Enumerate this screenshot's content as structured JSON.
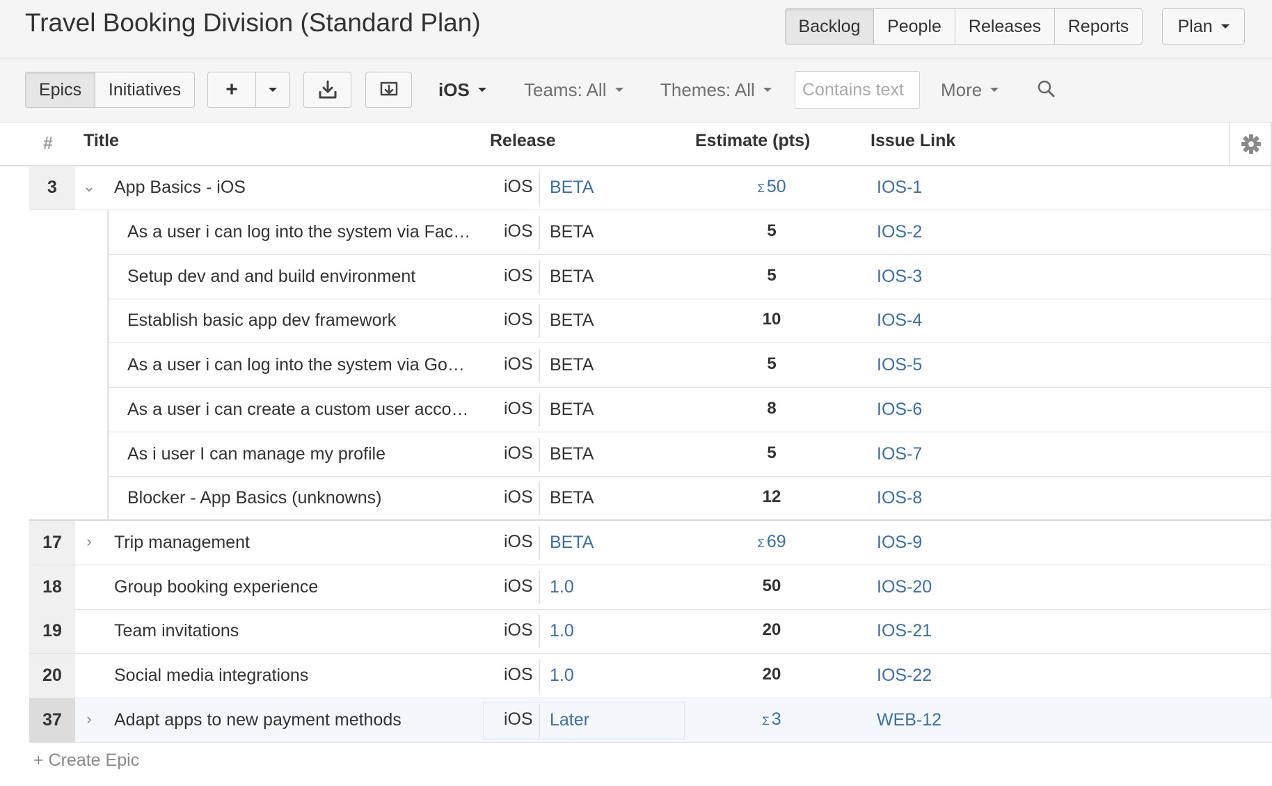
{
  "header": {
    "title": "Travel Booking Division (Standard Plan)",
    "nav": [
      "Backlog",
      "People",
      "Releases",
      "Reports"
    ],
    "active_nav": "Backlog",
    "plan_label": "Plan"
  },
  "toolbar": {
    "view_tabs": [
      "Epics",
      "Initiatives"
    ],
    "active_view": "Epics",
    "add_label": "+",
    "team_filter": "iOS",
    "teams_filter": "Teams: All",
    "themes_filter": "Themes: All",
    "search_placeholder": "Contains text",
    "more_label": "More"
  },
  "table": {
    "columns": {
      "num": "#",
      "title": "Title",
      "release": "Release",
      "estimate": "Estimate (pts)",
      "issue": "Issue Link"
    },
    "rows": [
      {
        "num": "3",
        "title": "App Basics - iOS",
        "team": "iOS",
        "release": "BETA",
        "estimate": "50",
        "issue": "IOS-1"
      },
      {
        "num": "",
        "title": "As a user i can log into the system via Fac…",
        "team": "iOS",
        "release": "BETA",
        "estimate": "5",
        "issue": "IOS-2"
      },
      {
        "num": "",
        "title": "Setup dev and and build environment",
        "team": "iOS",
        "release": "BETA",
        "estimate": "5",
        "issue": "IOS-3"
      },
      {
        "num": "",
        "title": "Establish basic app dev framework",
        "team": "iOS",
        "release": "BETA",
        "estimate": "10",
        "issue": "IOS-4"
      },
      {
        "num": "",
        "title": "As a user i can log into the system via Go…",
        "team": "iOS",
        "release": "BETA",
        "estimate": "5",
        "issue": "IOS-5"
      },
      {
        "num": "",
        "title": "As a user i can create a custom user acco…",
        "team": "iOS",
        "release": "BETA",
        "estimate": "8",
        "issue": "IOS-6"
      },
      {
        "num": "",
        "title": "As i user I can manage my profile",
        "team": "iOS",
        "release": "BETA",
        "estimate": "5",
        "issue": "IOS-7"
      },
      {
        "num": "",
        "title": "Blocker - App Basics (unknowns)",
        "team": "iOS",
        "release": "BETA",
        "estimate": "12",
        "issue": "IOS-8"
      },
      {
        "num": "17",
        "title": "Trip management",
        "team": "iOS",
        "release": "BETA",
        "estimate": "69",
        "issue": "IOS-9"
      },
      {
        "num": "18",
        "title": "Group booking experience",
        "team": "iOS",
        "release": "1.0",
        "estimate": "50",
        "issue": "IOS-20"
      },
      {
        "num": "19",
        "title": "Team invitations",
        "team": "iOS",
        "release": "1.0",
        "estimate": "20",
        "issue": "IOS-21"
      },
      {
        "num": "20",
        "title": "Social media integrations",
        "team": "iOS",
        "release": "1.0",
        "estimate": "20",
        "issue": "IOS-22"
      },
      {
        "num": "37",
        "title": "Adapt apps to new payment methods",
        "team": "iOS",
        "release": "Later",
        "estimate": "3",
        "issue": "WEB-12"
      }
    ],
    "create_label": "+ Create Epic"
  },
  "colors": {
    "link": "#3a6fa8",
    "header_bg": "#f5f5f5",
    "row_highlight": "#f4f8fd"
  }
}
